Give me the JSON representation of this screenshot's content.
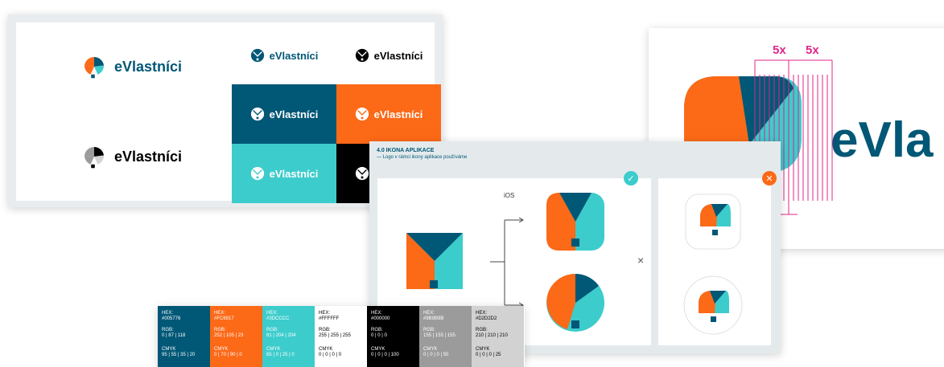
{
  "brand": {
    "wordmark": "eVlastníci",
    "colors": {
      "dark_blue": "#005776",
      "orange": "#FC6917",
      "turquoise": "#3DCCCC",
      "white": "#FFFFFF",
      "black": "#000000",
      "grey": "#9B9B9B",
      "light_grey": "#D2D2D2"
    }
  },
  "clearspace": {
    "label_left": "5x",
    "label_right": "5x",
    "wordmark_fragment": "eVla"
  },
  "app_icon": {
    "section_title": "4.0   IKONA APLIKACE",
    "section_subtitle": "— Logo v rámci ikony aplikace používáme",
    "ios_label": "iOS",
    "correct_icon": "check-icon",
    "wrong_icon": "cross-icon",
    "separator_icon": "times-icon"
  },
  "palette": [
    {
      "hex_label": "HEX:",
      "hex": "#005776",
      "rgb_label": "RGB:",
      "rgb": "0 | 87 | 118",
      "cmyk_label": "CMYK",
      "cmyk": "95 | 55 | 35 | 20",
      "bg": "#005776",
      "fg": "#ffffff"
    },
    {
      "hex_label": "HEX:",
      "hex": "#FC6917",
      "rgb_label": "RGB:",
      "rgb": "252 | 105 | 23",
      "cmyk_label": "CMYK",
      "cmyk": "0 | 70 | 90 | 0",
      "bg": "#FC6917",
      "fg": "#ffffff"
    },
    {
      "hex_label": "HEX:",
      "hex": "#3DCCCC",
      "rgb_label": "RGB:",
      "rgb": "61 | 204 | 204",
      "cmyk_label": "CMYK",
      "cmyk": "65 | 0 | 25 | 0",
      "bg": "#3DCCCC",
      "fg": "#ffffff"
    },
    {
      "hex_label": "HEX:",
      "hex": "#FFFFFF",
      "rgb_label": "RGB:",
      "rgb": "255 | 255 | 255",
      "cmyk_label": "CMYK",
      "cmyk": "0 | 0 | 0 | 0",
      "bg": "#FFFFFF",
      "fg": "#000000"
    },
    {
      "hex_label": "HEX:",
      "hex": "#000000",
      "rgb_label": "RGB:",
      "rgb": "0 | 0 | 0",
      "cmyk_label": "CMYK",
      "cmyk": "0 | 0 | 0 | 100",
      "bg": "#000000",
      "fg": "#ffffff"
    },
    {
      "hex_label": "HEX:",
      "hex": "#9B9B9B",
      "rgb_label": "RGB:",
      "rgb": "155 | 155 | 155",
      "cmyk_label": "CMYK",
      "cmyk": "0 | 0 | 0 | 50",
      "bg": "#9B9B9B",
      "fg": "#ffffff"
    },
    {
      "hex_label": "HEX:",
      "hex": "#D2D2D2",
      "rgb_label": "RGB:",
      "rgb": "210 | 210 | 210",
      "cmyk_label": "CMYK",
      "cmyk": "0 | 0 | 0 | 25",
      "bg": "#D2D2D2",
      "fg": "#000000"
    }
  ]
}
